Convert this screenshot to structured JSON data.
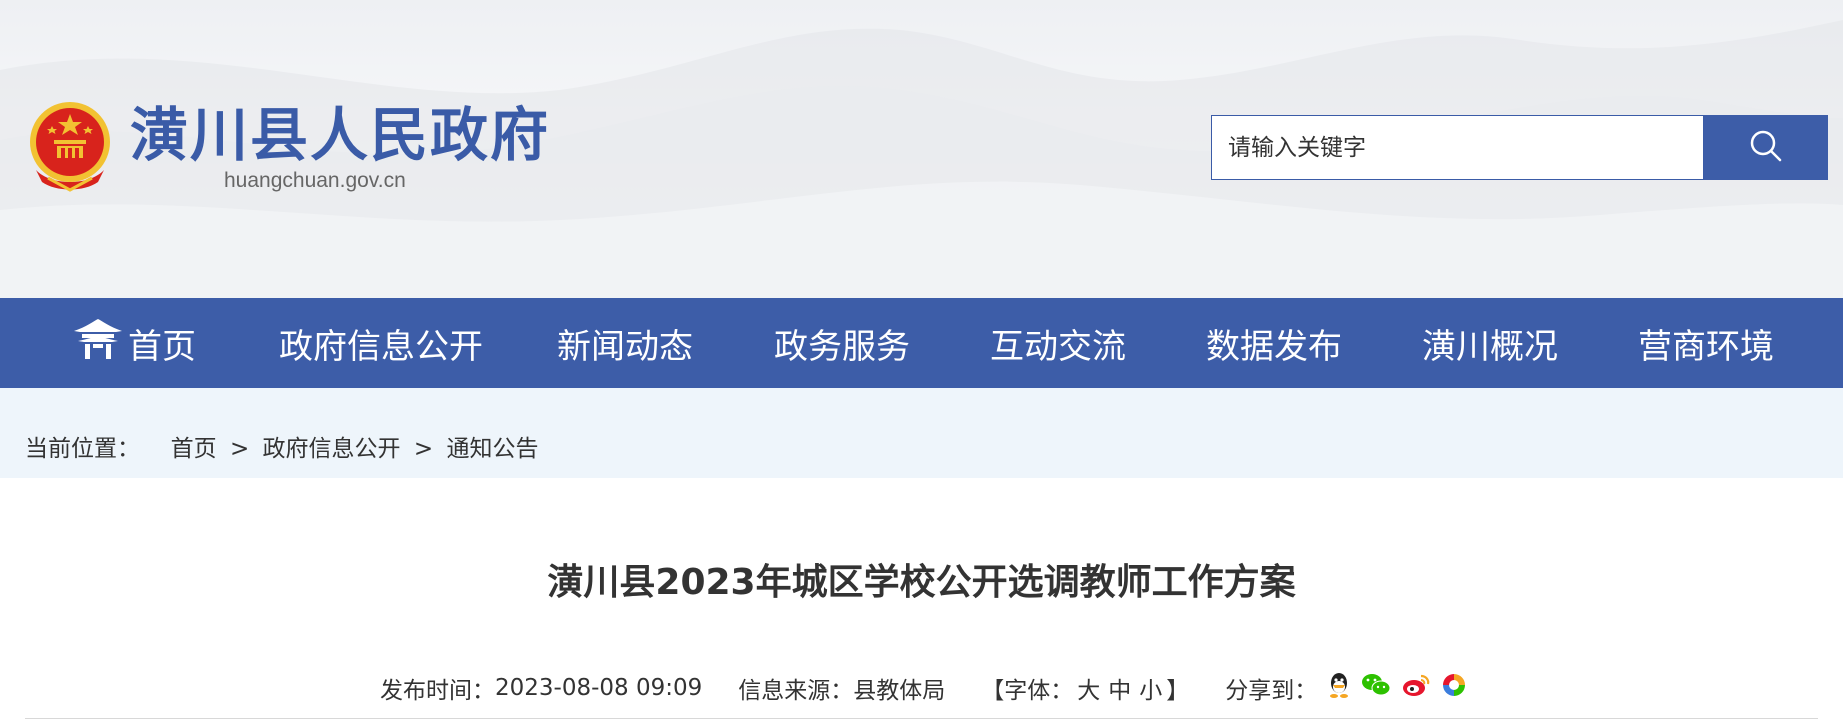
{
  "header": {
    "site_title": "潢川县人民政府",
    "site_domain": "huangchuan.gov.cn",
    "brand_color": "#3d5da8"
  },
  "search": {
    "placeholder": "请输入关键字",
    "button_icon": "search-icon"
  },
  "nav": {
    "home_icon": "home-pavilion-icon",
    "items": [
      {
        "label": "首页"
      },
      {
        "label": "政府信息公开"
      },
      {
        "label": "新闻动态"
      },
      {
        "label": "政务服务"
      },
      {
        "label": "互动交流"
      },
      {
        "label": "数据发布"
      },
      {
        "label": "潢川概况"
      },
      {
        "label": "营商环境"
      }
    ]
  },
  "breadcrumb": {
    "prefix": "当前位置：",
    "items": [
      "首页",
      "政府信息公开",
      "通知公告"
    ],
    "separator": ">"
  },
  "article": {
    "title": "潢川县2023年城区学校公开选调教师工作方案",
    "publish_label": "发布时间：",
    "publish_time": "2023-08-08 09:09",
    "source_label": "信息来源：",
    "source": "县教体局",
    "font_label_open": "【字体：",
    "font_large": "大",
    "font_medium": "中",
    "font_small": "小",
    "font_label_close": "】",
    "share_label": "分享到："
  }
}
